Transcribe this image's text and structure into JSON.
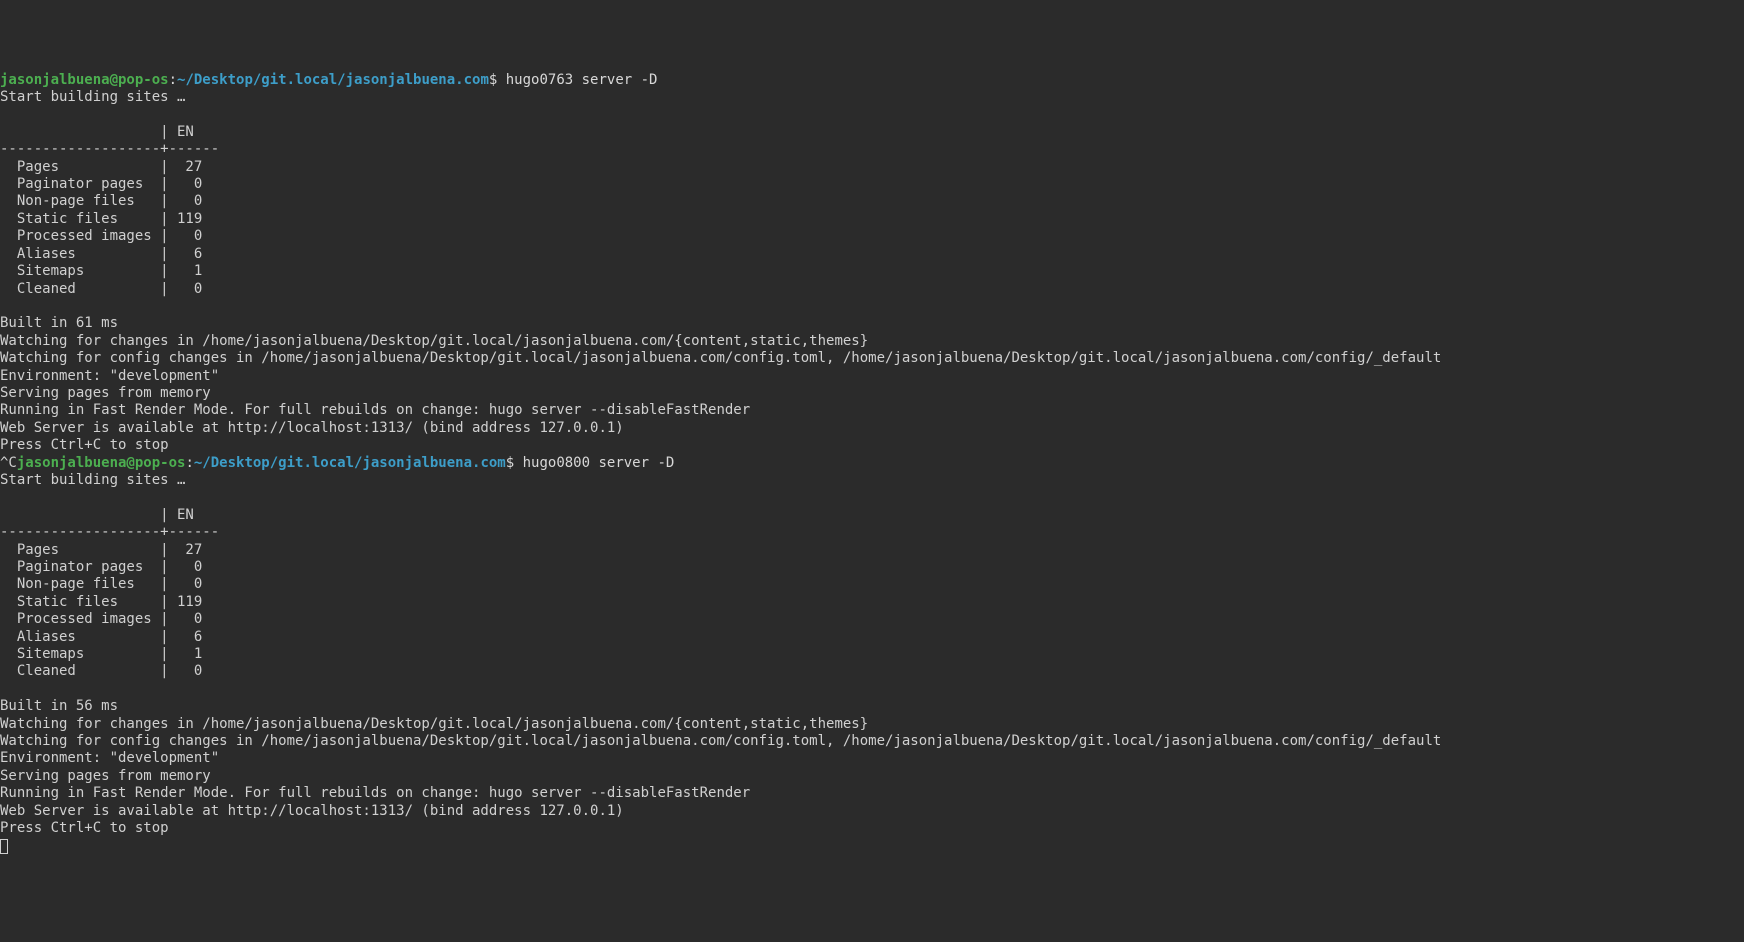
{
  "prompt1": {
    "user_host": "jasonjalbuena@pop-os",
    "colon": ":",
    "path": "~/Desktop/git.local/jasonjalbuena.com",
    "dollar": "$ ",
    "command": "hugo0763 server -D"
  },
  "output1": {
    "building": "Start building sites …",
    "table_header": "                   | EN   ",
    "table_sep": "-------------------+------",
    "rows": [
      "  Pages            |  27  ",
      "  Paginator pages  |   0  ",
      "  Non-page files   |   0  ",
      "  Static files     | 119  ",
      "  Processed images |   0  ",
      "  Aliases          |   6  ",
      "  Sitemaps         |   1  ",
      "  Cleaned          |   0  "
    ],
    "built_time": "Built in 61 ms",
    "watching_changes": "Watching for changes in /home/jasonjalbuena/Desktop/git.local/jasonjalbuena.com/{content,static,themes}",
    "watching_config": "Watching for config changes in /home/jasonjalbuena/Desktop/git.local/jasonjalbuena.com/config.toml, /home/jasonjalbuena/Desktop/git.local/jasonjalbuena.com/config/_default",
    "environment": "Environment: \"development\"",
    "serving": "Serving pages from memory",
    "fast_render": "Running in Fast Render Mode. For full rebuilds on change: hugo server --disableFastRender",
    "web_server": "Web Server is available at http://localhost:1313/ (bind address 127.0.0.1)",
    "ctrl_c": "Press Ctrl+C to stop",
    "interrupt": "^C"
  },
  "prompt2": {
    "user_host": "jasonjalbuena@pop-os",
    "colon": ":",
    "path": "~/Desktop/git.local/jasonjalbuena.com",
    "dollar": "$ ",
    "command": "hugo0800 server -D"
  },
  "output2": {
    "building": "Start building sites …",
    "table_header": "                   | EN   ",
    "table_sep": "-------------------+------",
    "rows": [
      "  Pages            |  27  ",
      "  Paginator pages  |   0  ",
      "  Non-page files   |   0  ",
      "  Static files     | 119  ",
      "  Processed images |   0  ",
      "  Aliases          |   6  ",
      "  Sitemaps         |   1  ",
      "  Cleaned          |   0  "
    ],
    "built_time": "Built in 56 ms",
    "watching_changes": "Watching for changes in /home/jasonjalbuena/Desktop/git.local/jasonjalbuena.com/{content,static,themes}",
    "watching_config": "Watching for config changes in /home/jasonjalbuena/Desktop/git.local/jasonjalbuena.com/config.toml, /home/jasonjalbuena/Desktop/git.local/jasonjalbuena.com/config/_default",
    "environment": "Environment: \"development\"",
    "serving": "Serving pages from memory",
    "fast_render": "Running in Fast Render Mode. For full rebuilds on change: hugo server --disableFastRender",
    "web_server": "Web Server is available at http://localhost:1313/ (bind address 127.0.0.1)",
    "ctrl_c": "Press Ctrl+C to stop"
  }
}
